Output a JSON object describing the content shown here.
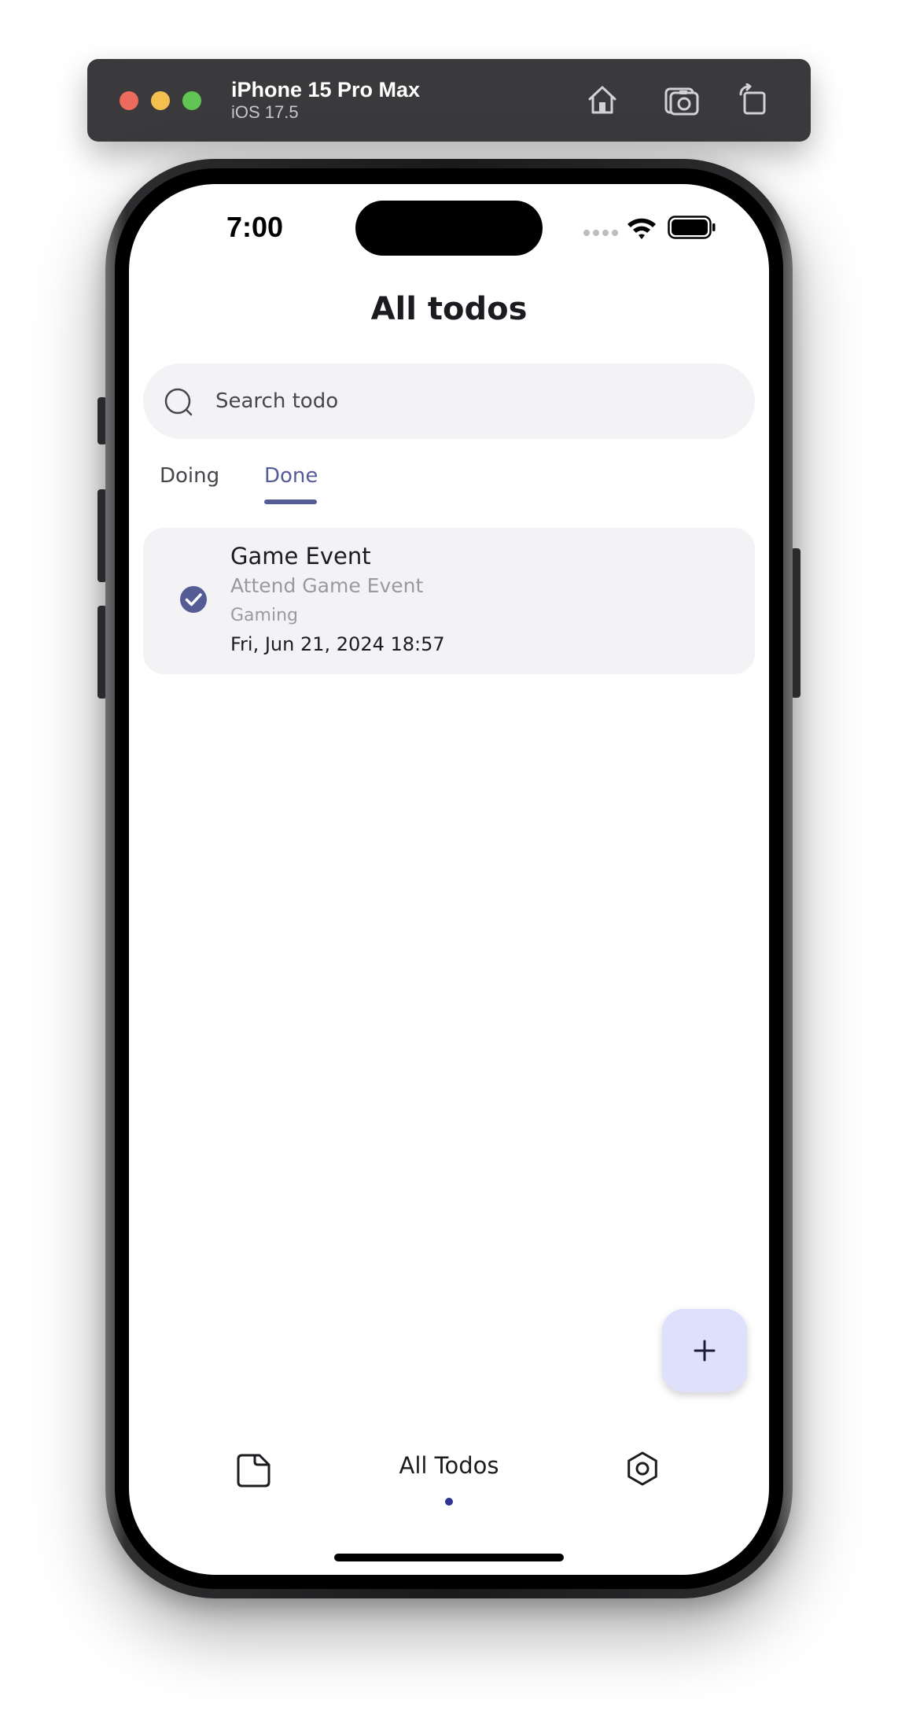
{
  "simulator": {
    "device_name": "iPhone 15 Pro Max",
    "os_version": "iOS 17.5"
  },
  "status_bar": {
    "time": "7:00"
  },
  "app": {
    "title": "All todos",
    "search": {
      "placeholder": "Search todo",
      "value": ""
    },
    "tabs": [
      {
        "label": "Doing",
        "selected": false
      },
      {
        "label": "Done",
        "selected": true
      }
    ],
    "todos": [
      {
        "title": "Game Event",
        "description": "Attend Game Event",
        "category": "Gaming",
        "datetime": "Fri, Jun 21, 2024 18:57",
        "completed": true
      }
    ],
    "fab_icon": "plus-icon",
    "bottom_nav": {
      "left_icon": "folder-icon",
      "center_label": "All Todos",
      "right_icon": "settings-icon"
    }
  },
  "colors": {
    "accent": "#555c95",
    "surface": "#f3f3f6",
    "fab_background": "#dfe0fb",
    "nav_dot": "#2d3590"
  }
}
